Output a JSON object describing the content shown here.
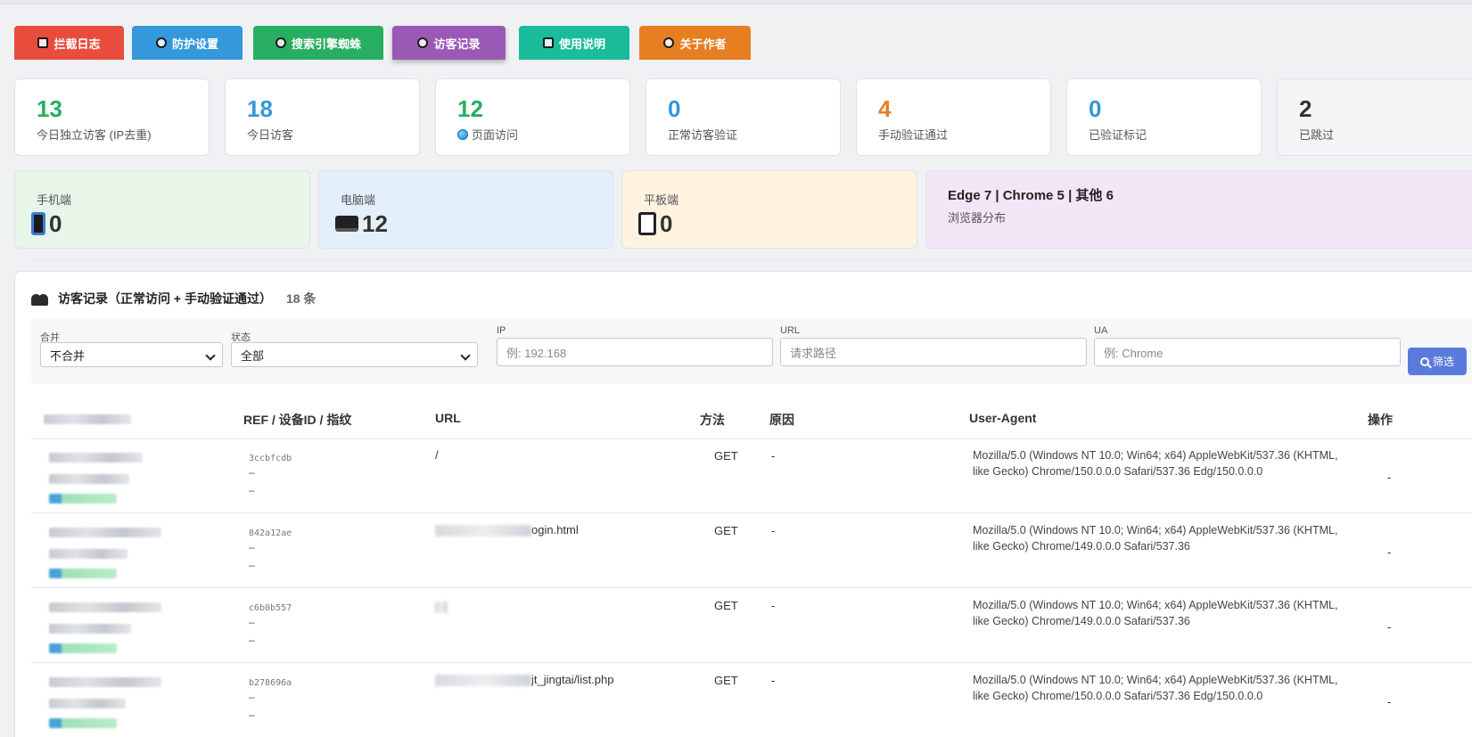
{
  "tabs": [
    {
      "label": "拦截日志",
      "color": "#e74c3c",
      "icon": "clipboard-icon"
    },
    {
      "label": "防护设置",
      "color": "#3498db",
      "icon": "gear-icon"
    },
    {
      "label": "搜索引擎蜘蛛",
      "color": "#27ae60",
      "icon": "spider-icon"
    },
    {
      "label": "访客记录",
      "color": "#9b59b6",
      "icon": "people-icon",
      "active": true
    },
    {
      "label": "使用说明",
      "color": "#1abc9c",
      "icon": "book-icon"
    },
    {
      "label": "关于作者",
      "color": "#e67e22",
      "icon": "user-icon"
    }
  ],
  "stats": [
    {
      "value": "13",
      "label": "今日独立访客 (IP去重)",
      "color": "#27ae60"
    },
    {
      "value": "18",
      "label": "今日访客",
      "color": "#3498db"
    },
    {
      "value": "12",
      "label": "页面访问",
      "color": "#27ae60"
    },
    {
      "value": "0",
      "label": "正常访客验证",
      "color": "#3498db"
    },
    {
      "value": "4",
      "label": "手动验证通过",
      "color": "#e67e22"
    },
    {
      "value": "0",
      "label": "已验证标记",
      "color": "#3498db"
    },
    {
      "value": "2",
      "label": "已跳过",
      "color": "#333333"
    }
  ],
  "devices": [
    {
      "value": "0",
      "label": "手机端",
      "bg": "#e8f5e9",
      "icon": "phone-icon"
    },
    {
      "value": "12",
      "label": "电脑端",
      "bg": "#e3f0fb",
      "icon": "laptop-icon"
    },
    {
      "value": "0",
      "label": "平板端",
      "bg": "#fff3e0",
      "icon": "tablet-icon"
    }
  ],
  "browsers": {
    "text": "Edge 7 | Chrome 5 | 其他 6",
    "label": "浏览器分布",
    "bg": "#f3e5f5"
  },
  "panel": {
    "title": "访客记录（正常访问 + 手动验证通过）",
    "count": "18 条"
  },
  "filters": {
    "merge": {
      "label": "合并",
      "value": "不合并"
    },
    "status": {
      "label": "状态",
      "value": "全部"
    },
    "ip": {
      "label": "IP",
      "placeholder": "例: 192.168"
    },
    "url": {
      "label": "URL",
      "placeholder": "请求路径"
    },
    "ua": {
      "label": "UA",
      "placeholder": "例: Chrome"
    },
    "button": "筛选"
  },
  "columns": {
    "ref": "REF / 设备ID / 指纹",
    "url": "URL",
    "method": "方法",
    "reason": "原因",
    "ua": "User-Agent",
    "action": "操作"
  },
  "rows": [
    {
      "ref": "3ccbfcdb",
      "dash1": "–",
      "dash2": "–",
      "url": "/",
      "url_suffix": "",
      "method": "GET",
      "reason": "-",
      "ua": "Mozilla/5.0 (Windows NT 10.0; Win64; x64) AppleWebKit/537.36 (KHTML, like Gecko) Chrome/150.0.0.0 Safari/537.36 Edg/150.0.0.0",
      "action": "-"
    },
    {
      "ref": "842a12ae",
      "dash1": "–",
      "dash2": "–",
      "url": "",
      "url_suffix": "ogin.html",
      "method": "GET",
      "reason": "-",
      "ua": "Mozilla/5.0 (Windows NT 10.0; Win64; x64) AppleWebKit/537.36 (KHTML, like Gecko) Chrome/149.0.0.0 Safari/537.36",
      "action": "-"
    },
    {
      "ref": "c6b0b557",
      "dash1": "–",
      "dash2": "–",
      "url": "",
      "url_suffix": "",
      "method": "GET",
      "reason": "-",
      "ua": "Mozilla/5.0 (Windows NT 10.0; Win64; x64) AppleWebKit/537.36 (KHTML, like Gecko) Chrome/149.0.0.0 Safari/537.36",
      "action": "-"
    },
    {
      "ref": "b278696a",
      "dash1": "–",
      "dash2": "–",
      "url": "",
      "url_suffix": "jt_jingtai/list.php",
      "method": "GET",
      "reason": "-",
      "ua": "Mozilla/5.0 (Windows NT 10.0; Win64; x64) AppleWebKit/537.36 (KHTML, like Gecko) Chrome/150.0.0.0 Safari/537.36 Edg/150.0.0.0",
      "action": "-"
    }
  ]
}
